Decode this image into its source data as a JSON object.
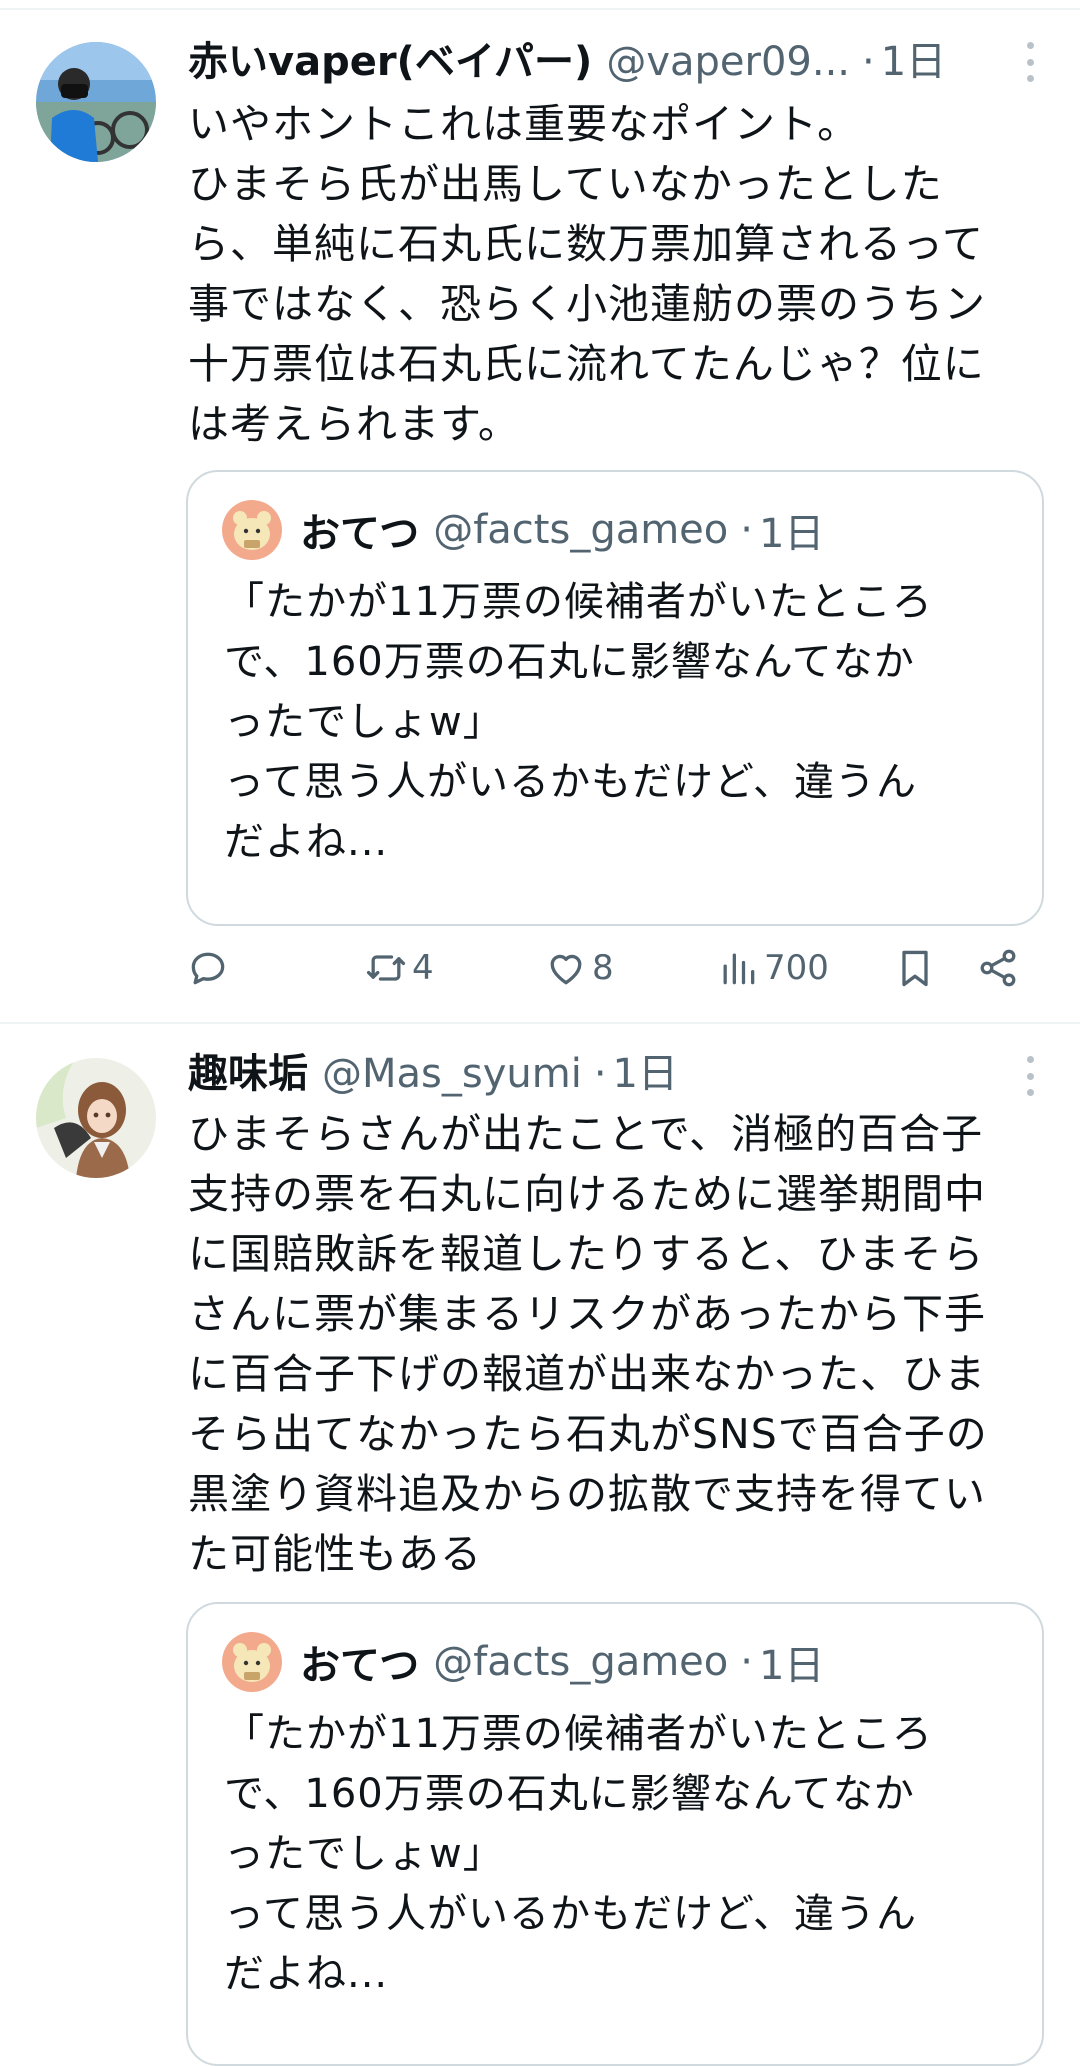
{
  "posts": [
    {
      "name": "赤いvaper(ベイパー)",
      "handle": "@vaper09...",
      "dot": "·",
      "time": "1日",
      "text": "いやホントこれは重要なポイント。\nひまそら氏が出馬していなかったとした\nら、単純に石丸氏に数万票加算されるって\n事ではなく、恐らく小池蓮舫の票のうちン\n十万票位は石丸氏に流れてたんじゃ？位に\nは考えられます。",
      "quote": {
        "name": "おてつ",
        "handle": "@facts_gameo",
        "dot": "·",
        "time": "1日",
        "text": "「たかが11万票の候補者がいたところ\nで、160万票の石丸に影響なんてなか\nったでしょw」\nって思う人がいるかもだけど、違うん\nだよね..."
      },
      "stats": {
        "retweets": "4",
        "likes": "8",
        "views": "700"
      }
    },
    {
      "name": "趣味垢",
      "handle": "@Mas_syumi",
      "dot": "·",
      "time": "1日",
      "text": "ひまそらさんが出たことで、消極的百合子\n支持の票を石丸に向けるために選挙期間中\nに国賠敗訴を報道したりすると、ひまそら\nさんに票が集まるリスクがあったから下手\nに百合子下げの報道が出来なかった、ひま\nそら出てなかったら石丸がSNSで百合子の\n黒塗り資料追及からの拡散で支持を得てい\nた可能性もある",
      "quote": {
        "name": "おてつ",
        "handle": "@facts_gameo",
        "dot": "·",
        "time": "1日",
        "text": "「たかが11万票の候補者がいたところ\nで、160万票の石丸に影響なんてなか\nったでしょw」\nって思う人がいるかもだけど、違うん\nだよね..."
      }
    }
  ],
  "icons": {
    "more": "more-vertical-icon",
    "reply": "reply-icon",
    "retweet": "retweet-icon",
    "like": "heart-icon",
    "views": "views-chart-icon",
    "bookmark": "bookmark-icon",
    "share": "share-icon"
  },
  "colors": {
    "text": "#0f1419",
    "secondary": "#536471",
    "border": "#cfd9de",
    "divider": "#eff3f4"
  }
}
